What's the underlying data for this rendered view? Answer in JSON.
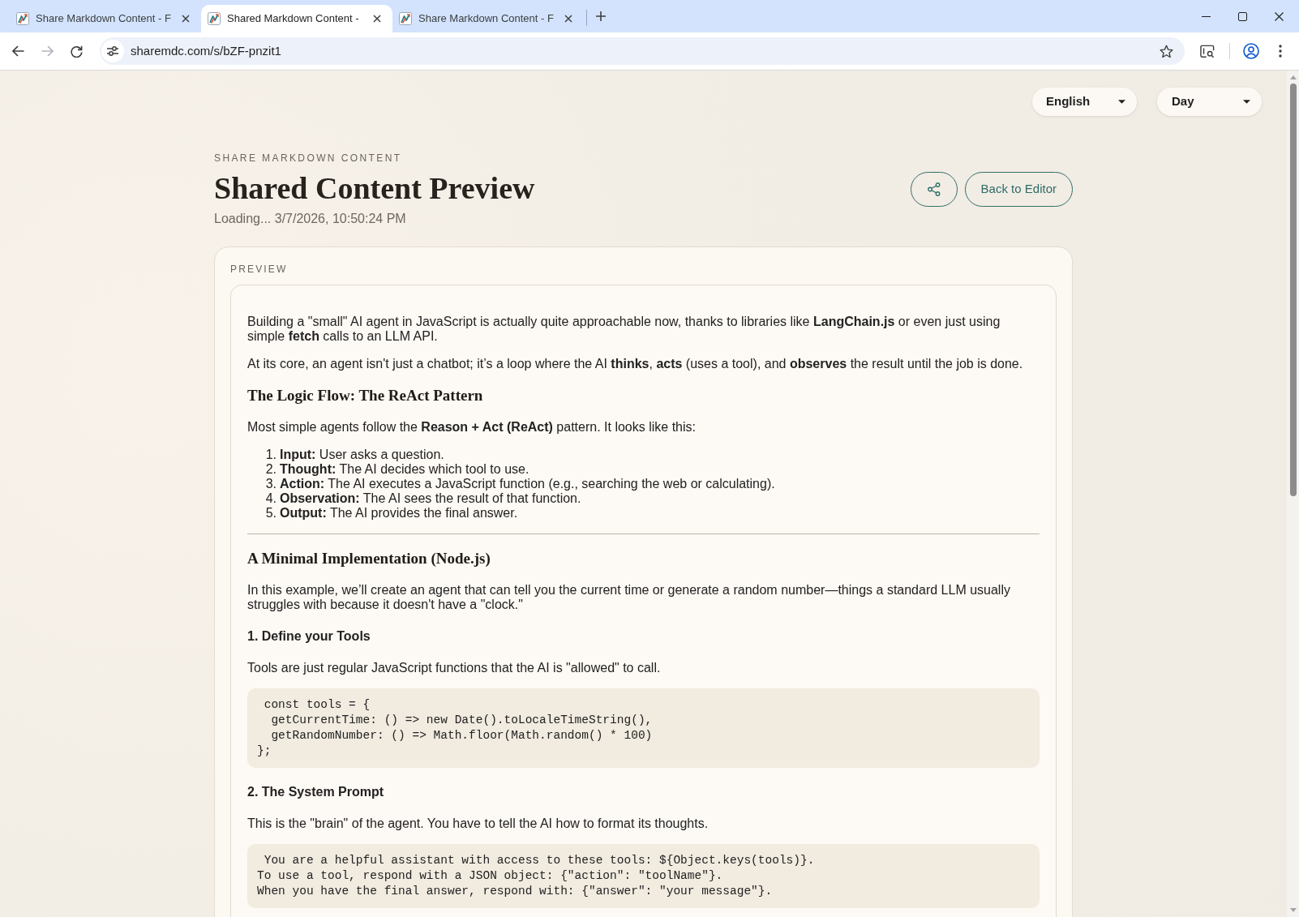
{
  "browser": {
    "tabs": [
      {
        "title": "Share Markdown Content - F",
        "selected": false
      },
      {
        "title": "Shared Markdown Content -",
        "selected": true
      },
      {
        "title": "Share Markdown Content - F",
        "selected": false
      }
    ],
    "forward_disabled": true,
    "url": "sharemdc.com/s/bZF-pnzit1"
  },
  "controls": {
    "language": "English",
    "theme": "Day"
  },
  "header": {
    "eyebrow": "SHARE MARKDOWN CONTENT",
    "title": "Shared Content Preview",
    "subtitle": "Loading... 3/7/2026, 10:50:24 PM",
    "back_button": "Back to Editor"
  },
  "preview": {
    "label": "PREVIEW",
    "blocks": [
      {
        "kind": "paragraph",
        "text": "Building a \"small\" AI agent in JavaScript is actually quite approachable now, thanks to libraries like **LangChain.js** or even just using simple **fetch** calls to an LLM API."
      },
      {
        "kind": "paragraph",
        "text": "At its core, an agent isn't just a chatbot; it’s a loop where the AI **thinks**, **acts** (uses a tool), and **observes** the result until the job is done."
      },
      {
        "kind": "heading",
        "text": "The Logic Flow: The ReAct Pattern"
      },
      {
        "kind": "paragraph",
        "text": "Most simple agents follow the **Reason + Act (ReAct)** pattern. It looks like this:"
      },
      {
        "kind": "list",
        "items": [
          {
            "marker": "1.",
            "text": "**Input:** User asks a question."
          },
          {
            "marker": "2.",
            "text": "**Thought:** The AI decides which tool to use."
          },
          {
            "marker": "3.",
            "text": "**Action:** The AI executes a JavaScript function (e.g., searching the web or calculating)."
          },
          {
            "marker": "4.",
            "text": "**Observation:** The AI sees the result of that function."
          },
          {
            "marker": "5.",
            "text": "**Output:** The AI provides the final answer."
          }
        ]
      },
      {
        "kind": "rule"
      },
      {
        "kind": "heading",
        "text": "A Minimal Implementation (Node.js)"
      },
      {
        "kind": "paragraph",
        "text": "In this example, we’ll create an agent that can tell you the current time or generate a random number—things a standard LLM usually struggles with because it doesn't have a \"clock.\""
      },
      {
        "kind": "subheading",
        "text": "1. Define your Tools"
      },
      {
        "kind": "paragraph",
        "text": "Tools are just regular JavaScript functions that the AI is \"allowed\" to call."
      },
      {
        "kind": "code",
        "lines": [
          " const tools = {",
          "  getCurrentTime: () => new Date().toLocaleTimeString(),",
          "  getRandomNumber: () => Math.floor(Math.random() * 100)",
          "};"
        ]
      },
      {
        "kind": "subheading",
        "text": "2. The System Prompt"
      },
      {
        "kind": "paragraph",
        "text": "This is the \"brain\" of the agent. You have to tell the AI how to format its thoughts."
      },
      {
        "kind": "code",
        "lines": [
          " You are a helpful assistant with access to these tools: ${Object.keys(tools)}.",
          "To use a tool, respond with a JSON object: {\"action\": \"toolName\"}.",
          "When you have the final answer, respond with: {\"answer\": \"your message\"}."
        ]
      }
    ]
  }
}
